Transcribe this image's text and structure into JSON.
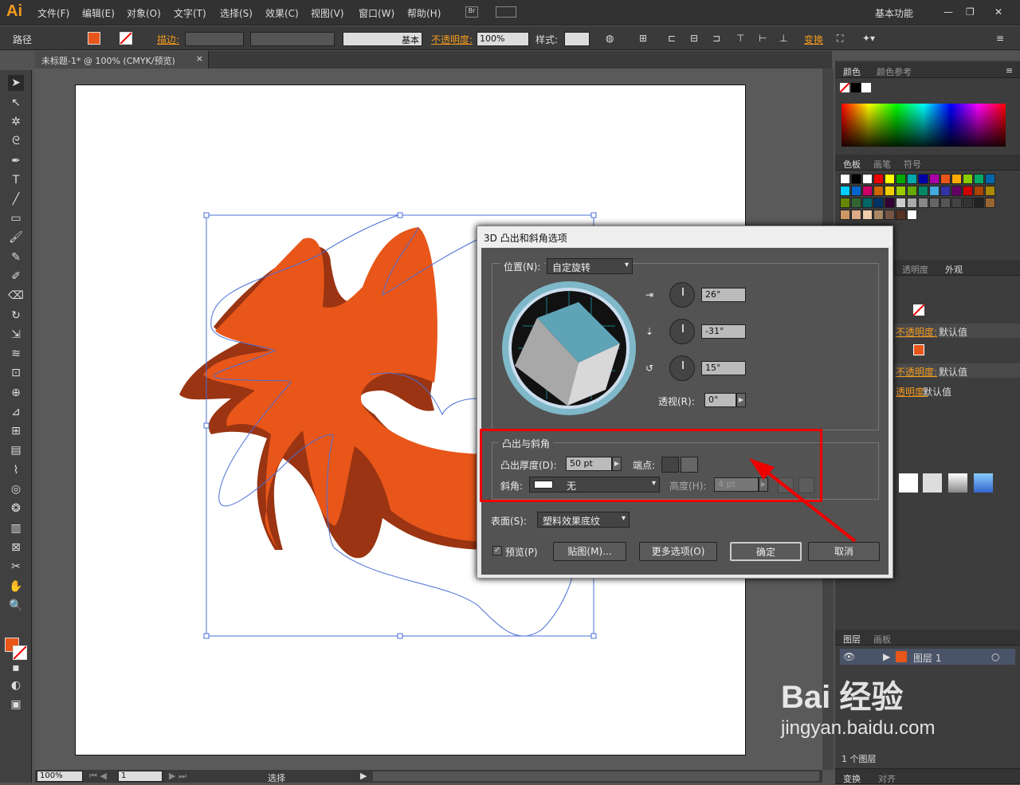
{
  "app": {
    "logo": "Ai"
  },
  "menu": [
    "文件(F)",
    "编辑(E)",
    "对象(O)",
    "文字(T)",
    "选择(S)",
    "效果(C)",
    "视图(V)",
    "窗口(W)",
    "帮助(H)"
  ],
  "workspace": "基本功能",
  "control_bar": {
    "selection_type": "路径",
    "stroke_label": "描边:",
    "stroke_style": "基本",
    "opacity_label": "不透明度:",
    "opacity_value": "100%",
    "style_label": "样式:",
    "transform_label": "变换"
  },
  "document_tab": "未标题-1* @ 100% (CMYK/预览)",
  "status": {
    "zoom": "100%",
    "page": "1",
    "tool": "选择"
  },
  "colors": {
    "fill": "#e8561a",
    "accent": "#e00000",
    "shadow": "#9a3412"
  },
  "panels": {
    "color_tabs": [
      "颜色",
      "颜色参考"
    ],
    "swatch_tabs": [
      "色板",
      "画笔",
      "符号"
    ],
    "appearance_tabs": [
      "透明度",
      "外观"
    ],
    "appearance_rows": [
      "不透明度: 默认值",
      "不透明度: 默认值",
      "透明度: 默认值"
    ],
    "appearance_values": [
      "默认值",
      "默认值",
      "默认值"
    ],
    "layers_tabs": [
      "图层",
      "画板"
    ],
    "layer_name": "图层 1",
    "layer_count": "1 个图层",
    "bottom_tabs": [
      "变换",
      "对齐"
    ]
  },
  "dialog": {
    "title": "3D 凸出和斜角选项",
    "position_label": "位置(N):",
    "position_value": "自定旋转",
    "rot_x": "26°",
    "rot_y": "-31°",
    "rot_z": "15°",
    "perspective_label": "透视(R):",
    "perspective_value": "0°",
    "extrude_group": "凸出与斜角",
    "depth_label": "凸出厚度(D):",
    "depth_value": "50 pt",
    "cap_label": "端点:",
    "bevel_label": "斜角:",
    "bevel_value": "无",
    "height_label": "高度(H):",
    "height_value": "4 pt",
    "surface_label": "表面(S):",
    "surface_value": "塑料效果底纹",
    "preview_label": "预览(P)",
    "map_button": "贴图(M)...",
    "more_button": "更多选项(O)",
    "ok_button": "确定",
    "cancel_button": "取消"
  },
  "watermark": {
    "brand": "Bai 经验",
    "url": "jingyan.baidu.com"
  }
}
